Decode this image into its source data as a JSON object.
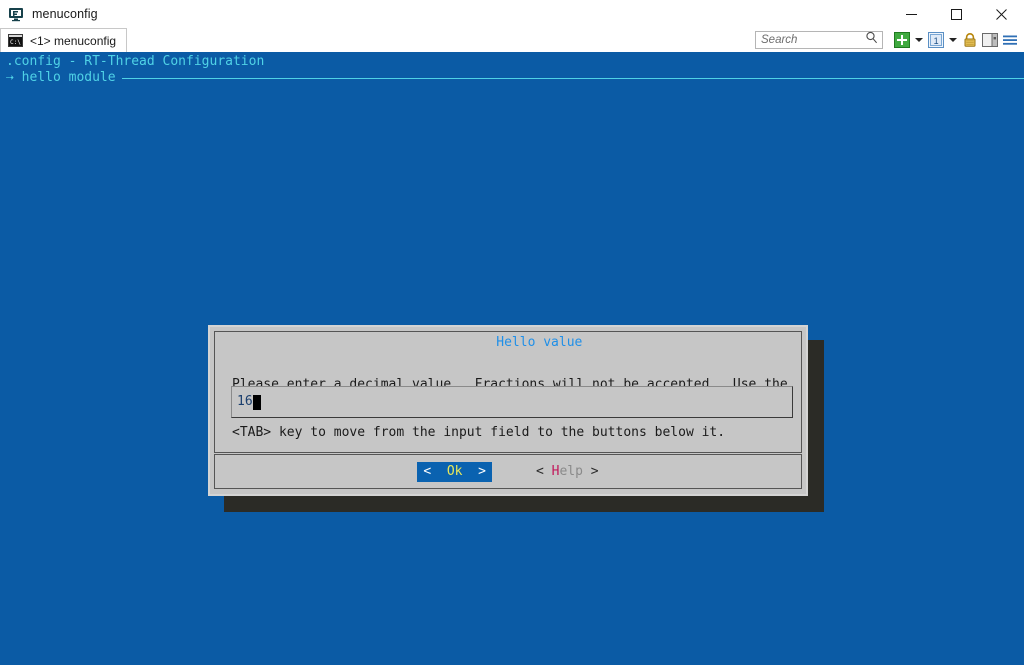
{
  "window": {
    "title": "menuconfig",
    "app_icon": "terminal-monitor-icon",
    "controls": {
      "minimize": "minimize-icon",
      "maximize": "maximize-icon",
      "close": "close-icon"
    }
  },
  "tabstrip": {
    "tabs": [
      {
        "label": "<1> menuconfig",
        "icon": "console-icon",
        "active": true
      }
    ],
    "search": {
      "placeholder": "Search",
      "value": "",
      "icon": "search-icon"
    },
    "toolbar": [
      {
        "name": "new-tab-button",
        "icon": "green-plus-icon"
      },
      {
        "name": "new-tab-dropdown",
        "icon": "chevron-down-icon"
      },
      {
        "name": "tab-list-button",
        "icon": "tab-one-icon",
        "label": "1"
      },
      {
        "name": "tab-list-dropdown",
        "icon": "chevron-down-icon"
      },
      {
        "name": "lock-button",
        "icon": "padlock-icon"
      },
      {
        "name": "panel-toggle-button",
        "icon": "split-panel-icon"
      },
      {
        "name": "menu-button",
        "icon": "hamburger-menu-icon"
      }
    ]
  },
  "terminal": {
    "header_line1": ".config - RT-Thread Configuration",
    "header_line2": "⇢ hello module",
    "background_color": "#0b5ba5",
    "text_color": "#4fd2e6"
  },
  "dialog": {
    "title": "Hello value",
    "body_line1": "Please enter a decimal value.  Fractions will not be accepted.  Use the",
    "body_line2": "<TAB> key to move from the input field to the buttons below it.",
    "input": {
      "value": "16",
      "cursor": "block-caret"
    },
    "buttons": [
      {
        "name": "ok-button",
        "label": "Ok",
        "left_bracket": "<",
        "right_bracket": ">",
        "selected": true,
        "selected_bg": "#0a62b0",
        "label_color": "#e8e85a"
      },
      {
        "name": "help-button",
        "label": "Help",
        "hotkey": "H",
        "rest": "elp",
        "left_bracket": "<",
        "right_bracket": ">",
        "selected": false,
        "hotkey_color": "#c2185b"
      }
    ]
  }
}
